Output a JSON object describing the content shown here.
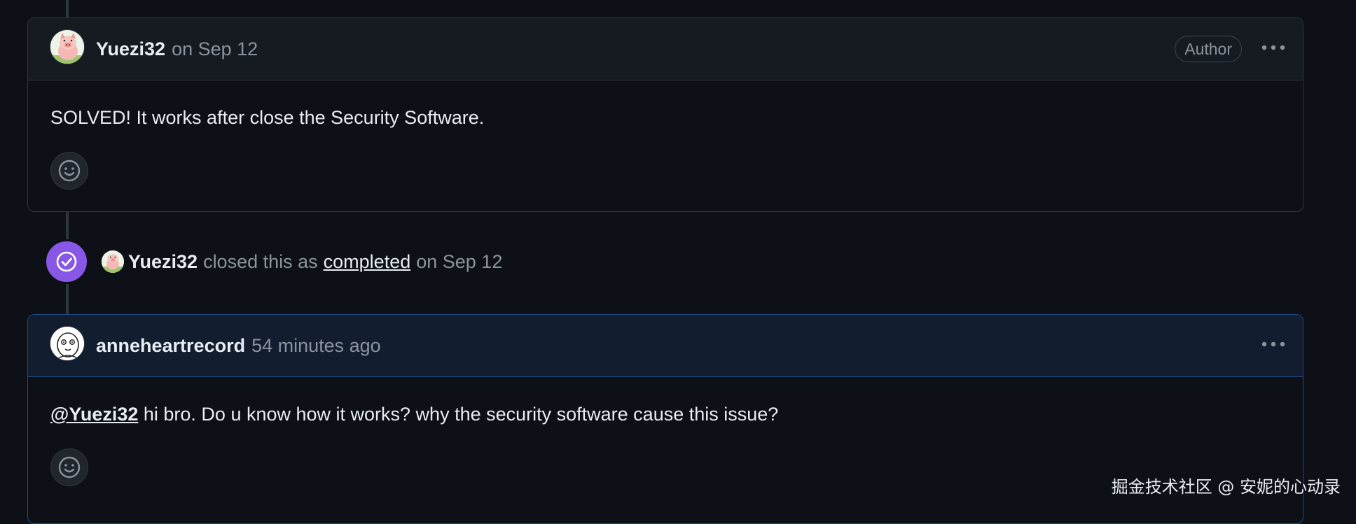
{
  "comments": [
    {
      "author": "Yuezi32",
      "date": "on Sep 12",
      "badge": "Author",
      "body": "SOLVED! It works after close the Security Software.",
      "avatar_icon": "pig-avatar-icon"
    },
    {
      "author": "anneheartrecord",
      "date": "54 minutes ago",
      "mention": "@Yuezi32",
      "body": " hi bro. Do u know how it works? why the security software cause this issue?",
      "avatar_icon": "cartoon-face-avatar-icon"
    }
  ],
  "event": {
    "actor": "Yuezi32",
    "action_prefix": "closed this as",
    "status_link": "completed",
    "date": "on Sep 12",
    "icon": "check-circle-icon",
    "badge_color": "#8957e5"
  },
  "watermark": "掘金技术社区 @ 安妮的心动录",
  "colors": {
    "background": "#0d1117",
    "header_bg": "#161b22",
    "highlight_header_bg": "#121d2f",
    "border": "#30363d",
    "highlight_border": "#1f4a85",
    "muted_text": "#8b949e",
    "text": "#e6edf3"
  }
}
